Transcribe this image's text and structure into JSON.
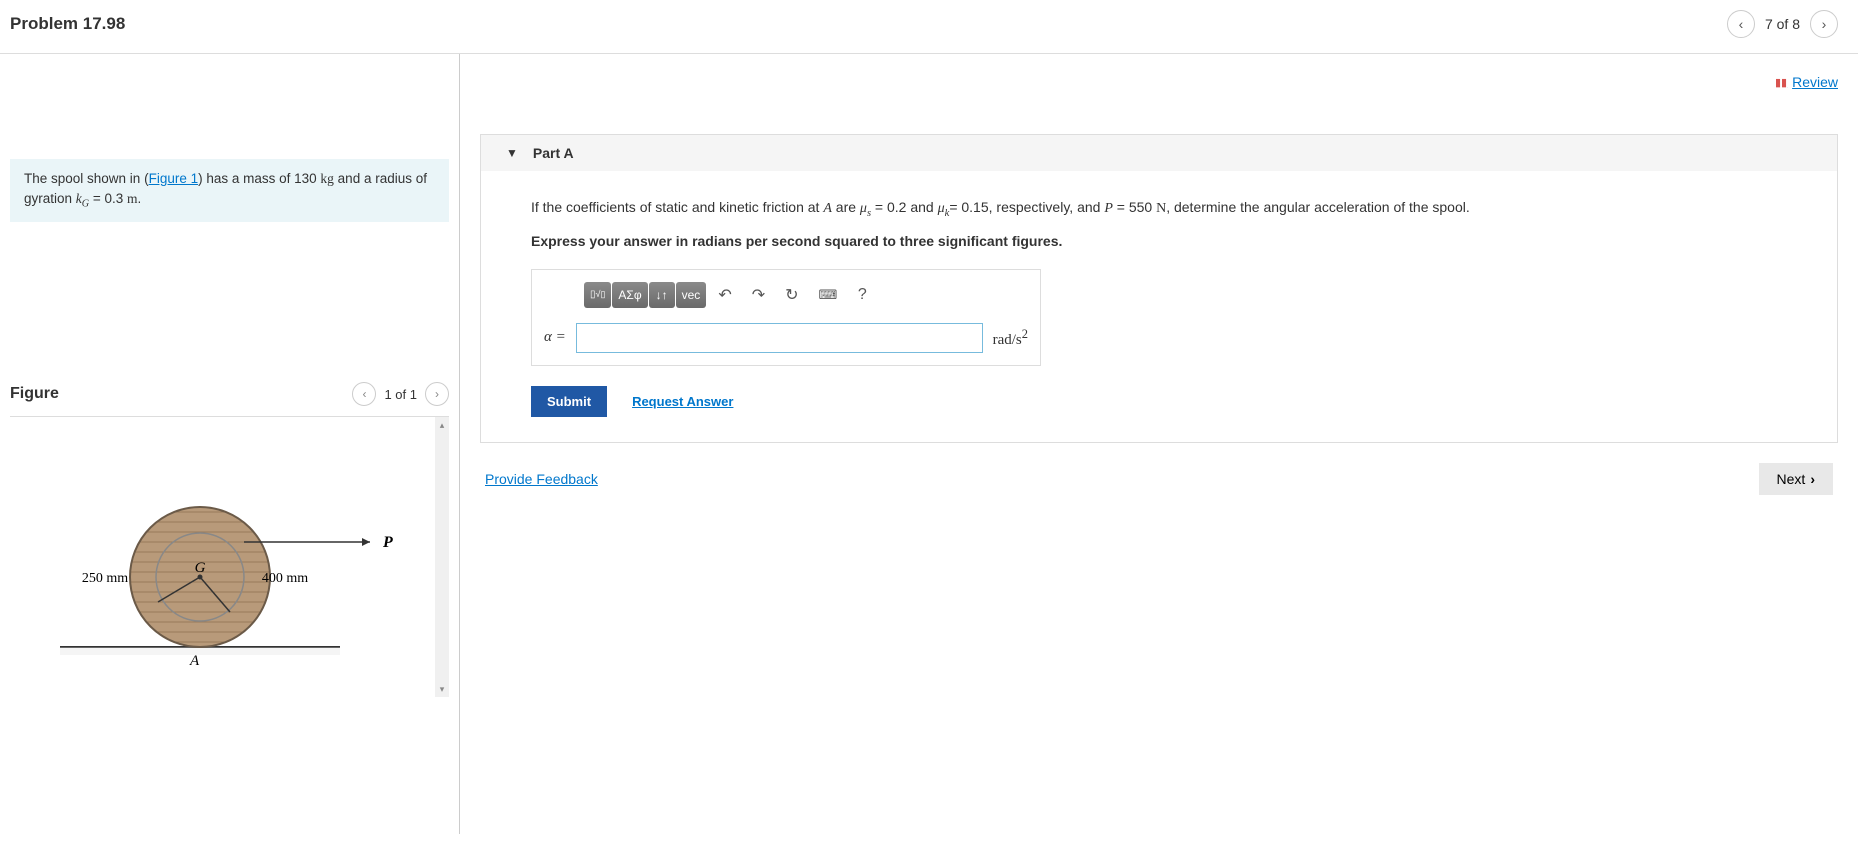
{
  "header": {
    "title": "Problem 17.98",
    "counter": "7 of 8"
  },
  "problem": {
    "text_before_link": "The spool shown in (",
    "figure_link": "Figure 1",
    "text_after_link": ") has a mass of 130 ",
    "mass_unit": "kg",
    "text_middle": " and a radius of gyration ",
    "kg_var": "k",
    "kg_sub": "G",
    "kg_equals": " = 0.3 ",
    "kg_unit": "m",
    "text_end": "."
  },
  "figure": {
    "title": "Figure",
    "counter": "1 of 1",
    "label_250": "250 mm",
    "label_400": "400 mm",
    "label_G": "G",
    "label_P": "P",
    "label_A": "A"
  },
  "review": {
    "label": "Review"
  },
  "part": {
    "title": "Part A",
    "question_prefix": "If the coefficients of static and kinetic friction at ",
    "var_A": "A",
    "question_mid1": " are ",
    "mu_s": "μ",
    "mu_s_sub": "s",
    "mu_s_val": " = 0.2 and ",
    "mu_k": "μ",
    "mu_k_sub": "k",
    "mu_k_val": "= 0.15, respectively, and ",
    "var_P": "P",
    "p_val": " = 550 ",
    "p_unit": "N",
    "question_end": ", determine the angular acceleration of the spool.",
    "instruction": "Express your answer in radians per second squared to three significant figures.",
    "toolbar": {
      "template": "▢",
      "math": "ΑΣφ",
      "arrows": "↓↑",
      "vec": "vec",
      "undo": "↶",
      "redo": "↷",
      "reset": "↻",
      "keyboard": "⌨",
      "help": "?"
    },
    "var_label": "α =",
    "unit_label_prefix": "rad/s",
    "unit_label_sup": "2",
    "submit": "Submit",
    "request_answer": "Request Answer"
  },
  "footer": {
    "provide_feedback": "Provide Feedback",
    "next": "Next"
  }
}
